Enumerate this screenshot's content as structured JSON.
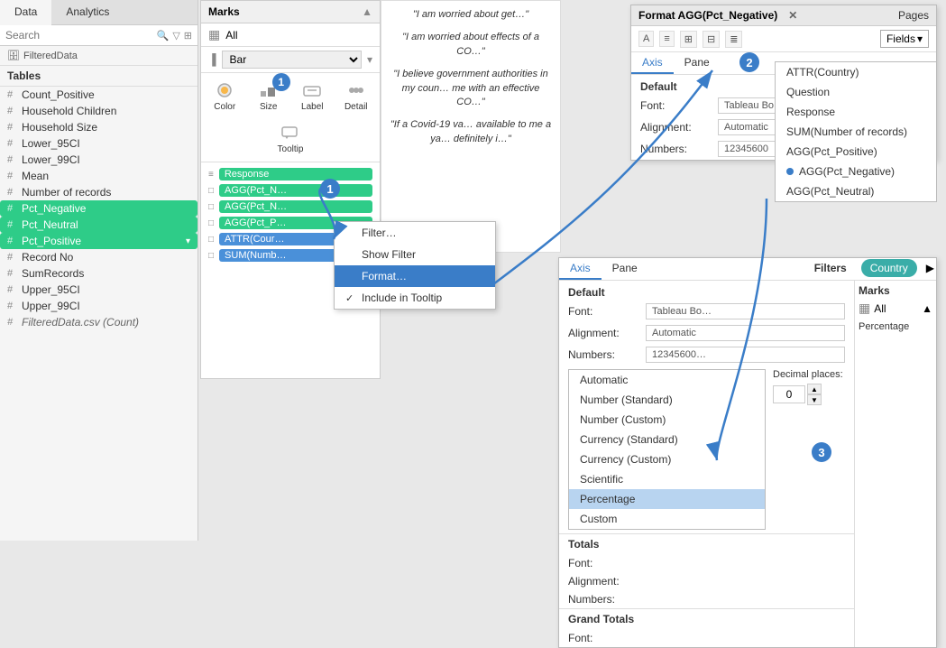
{
  "leftPanel": {
    "tabs": [
      "Data",
      "Analytics"
    ],
    "activeTab": "Data",
    "filteredData": "FilteredData",
    "searchPlaceholder": "Search",
    "tablesLabel": "Tables",
    "items": [
      {
        "label": "Count_Positive",
        "type": "measure"
      },
      {
        "label": "Household Children",
        "type": "measure"
      },
      {
        "label": "Household Size",
        "type": "measure"
      },
      {
        "label": "Lower_95CI",
        "type": "measure"
      },
      {
        "label": "Lower_99CI",
        "type": "measure"
      },
      {
        "label": "Mean",
        "type": "measure"
      },
      {
        "label": "Number of records",
        "type": "measure"
      },
      {
        "label": "Pct_Negative",
        "type": "measure",
        "highlighted": true
      },
      {
        "label": "Pct_Neutral",
        "type": "measure",
        "highlighted": true
      },
      {
        "label": "Pct_Positive",
        "type": "measure",
        "highlighted": true,
        "arrow": true
      },
      {
        "label": "Record No",
        "type": "measure"
      },
      {
        "label": "SumRecords",
        "type": "measure"
      },
      {
        "label": "Upper_95CI",
        "type": "measure"
      },
      {
        "label": "Upper_99CI",
        "type": "measure"
      },
      {
        "label": "FilteredData.csv (Count)",
        "type": "measure",
        "italic": true
      }
    ]
  },
  "marksPanel": {
    "title": "Marks",
    "allLabel": "All",
    "barLabel": "Bar",
    "iconLabels": [
      "Color",
      "Size",
      "Label",
      "Detail",
      "Tooltip"
    ],
    "fields": [
      {
        "tag": "Response",
        "icon": "≡",
        "color": "green"
      },
      {
        "tag": "AGG(Pct_N…",
        "icon": "□",
        "color": "green"
      },
      {
        "tag": "AGG(Pct_N…",
        "icon": "□",
        "color": "green"
      },
      {
        "tag": "AGG(Pct_P…",
        "icon": "□",
        "color": "green"
      },
      {
        "tag": "ATTR(Cour…",
        "icon": "□",
        "color": "blue"
      },
      {
        "tag": "SUM(Numb…",
        "icon": "□",
        "color": "blue"
      }
    ]
  },
  "bgText": {
    "quotes": [
      "\"I am worried about get…\"",
      "\"I am worried about effects of a CO…\"",
      "\"I believe government authorities in my coun… me with an effective CO…\"",
      "\"If a Covid-19 va… available to me a ya… definitely i…\""
    ]
  },
  "contextMenu": {
    "items": [
      {
        "label": "Filter…",
        "check": false
      },
      {
        "label": "Show Filter",
        "check": false
      },
      {
        "label": "Format…",
        "check": false,
        "active": true
      },
      {
        "label": "Include in Tooltip",
        "check": true
      }
    ]
  },
  "formatPanelTop": {
    "title": "Format AGG(Pct_Negative)",
    "pagesLabel": "Pages",
    "toolbarBtns": [
      "A",
      "≡",
      "⊞",
      "⊟",
      "≣"
    ],
    "fieldsLabel": "Fields",
    "axisLabel": "Axis",
    "paneLabel": "Pane",
    "defaultLabel": "Default",
    "fontLabel": "Font:",
    "fontValue": "Tableau Bo…",
    "alignLabel": "Alignment:",
    "alignValue": "Automatic",
    "numbersLabel": "Numbers:",
    "numbersValue": "12345600",
    "fieldsList": [
      {
        "label": "ATTR(Country)"
      },
      {
        "label": "Question"
      },
      {
        "label": "Response"
      },
      {
        "label": "SUM(Number of records)"
      },
      {
        "label": "AGG(Pct_Positive)"
      },
      {
        "label": "AGG(Pct_Negative)",
        "selected": true
      },
      {
        "label": "AGG(Pct_Neutral)"
      }
    ]
  },
  "formatPanelBottom": {
    "axisLabel": "Axis",
    "paneLabel": "Pane",
    "filtersLabel": "Filters",
    "filterTag": "Country",
    "marksLabel": "Marks",
    "marksAllLabel": "All",
    "defaultLabel": "Default",
    "fontLabel": "Font:",
    "fontValue": "Tableau Bo…",
    "alignLabel": "Alignment:",
    "alignValue": "Automatic",
    "numbersLabel": "Numbers:",
    "numbersValue": "12345600…",
    "totalsLabel": "Totals",
    "totalsFontLabel": "Font:",
    "totalsAlignLabel": "Alignment:",
    "totalsNumbersLabel": "Numbers:",
    "grandTotalsLabel": "Grand Totals",
    "grandTotalsFontLabel": "Font:",
    "numberFormatOptions": [
      {
        "label": "Automatic"
      },
      {
        "label": "Number (Standard)"
      },
      {
        "label": "Number (Custom)"
      },
      {
        "label": "Currency (Standard)"
      },
      {
        "label": "Currency (Custom)"
      },
      {
        "label": "Scientific"
      },
      {
        "label": "Percentage",
        "selected": true
      },
      {
        "label": "Custom"
      }
    ],
    "decimalLabel": "Decimal places:",
    "decimalValue": "0"
  },
  "badges": [
    {
      "id": 1,
      "label": "1"
    },
    {
      "id": 2,
      "label": "2"
    },
    {
      "id": 3,
      "label": "3"
    }
  ]
}
